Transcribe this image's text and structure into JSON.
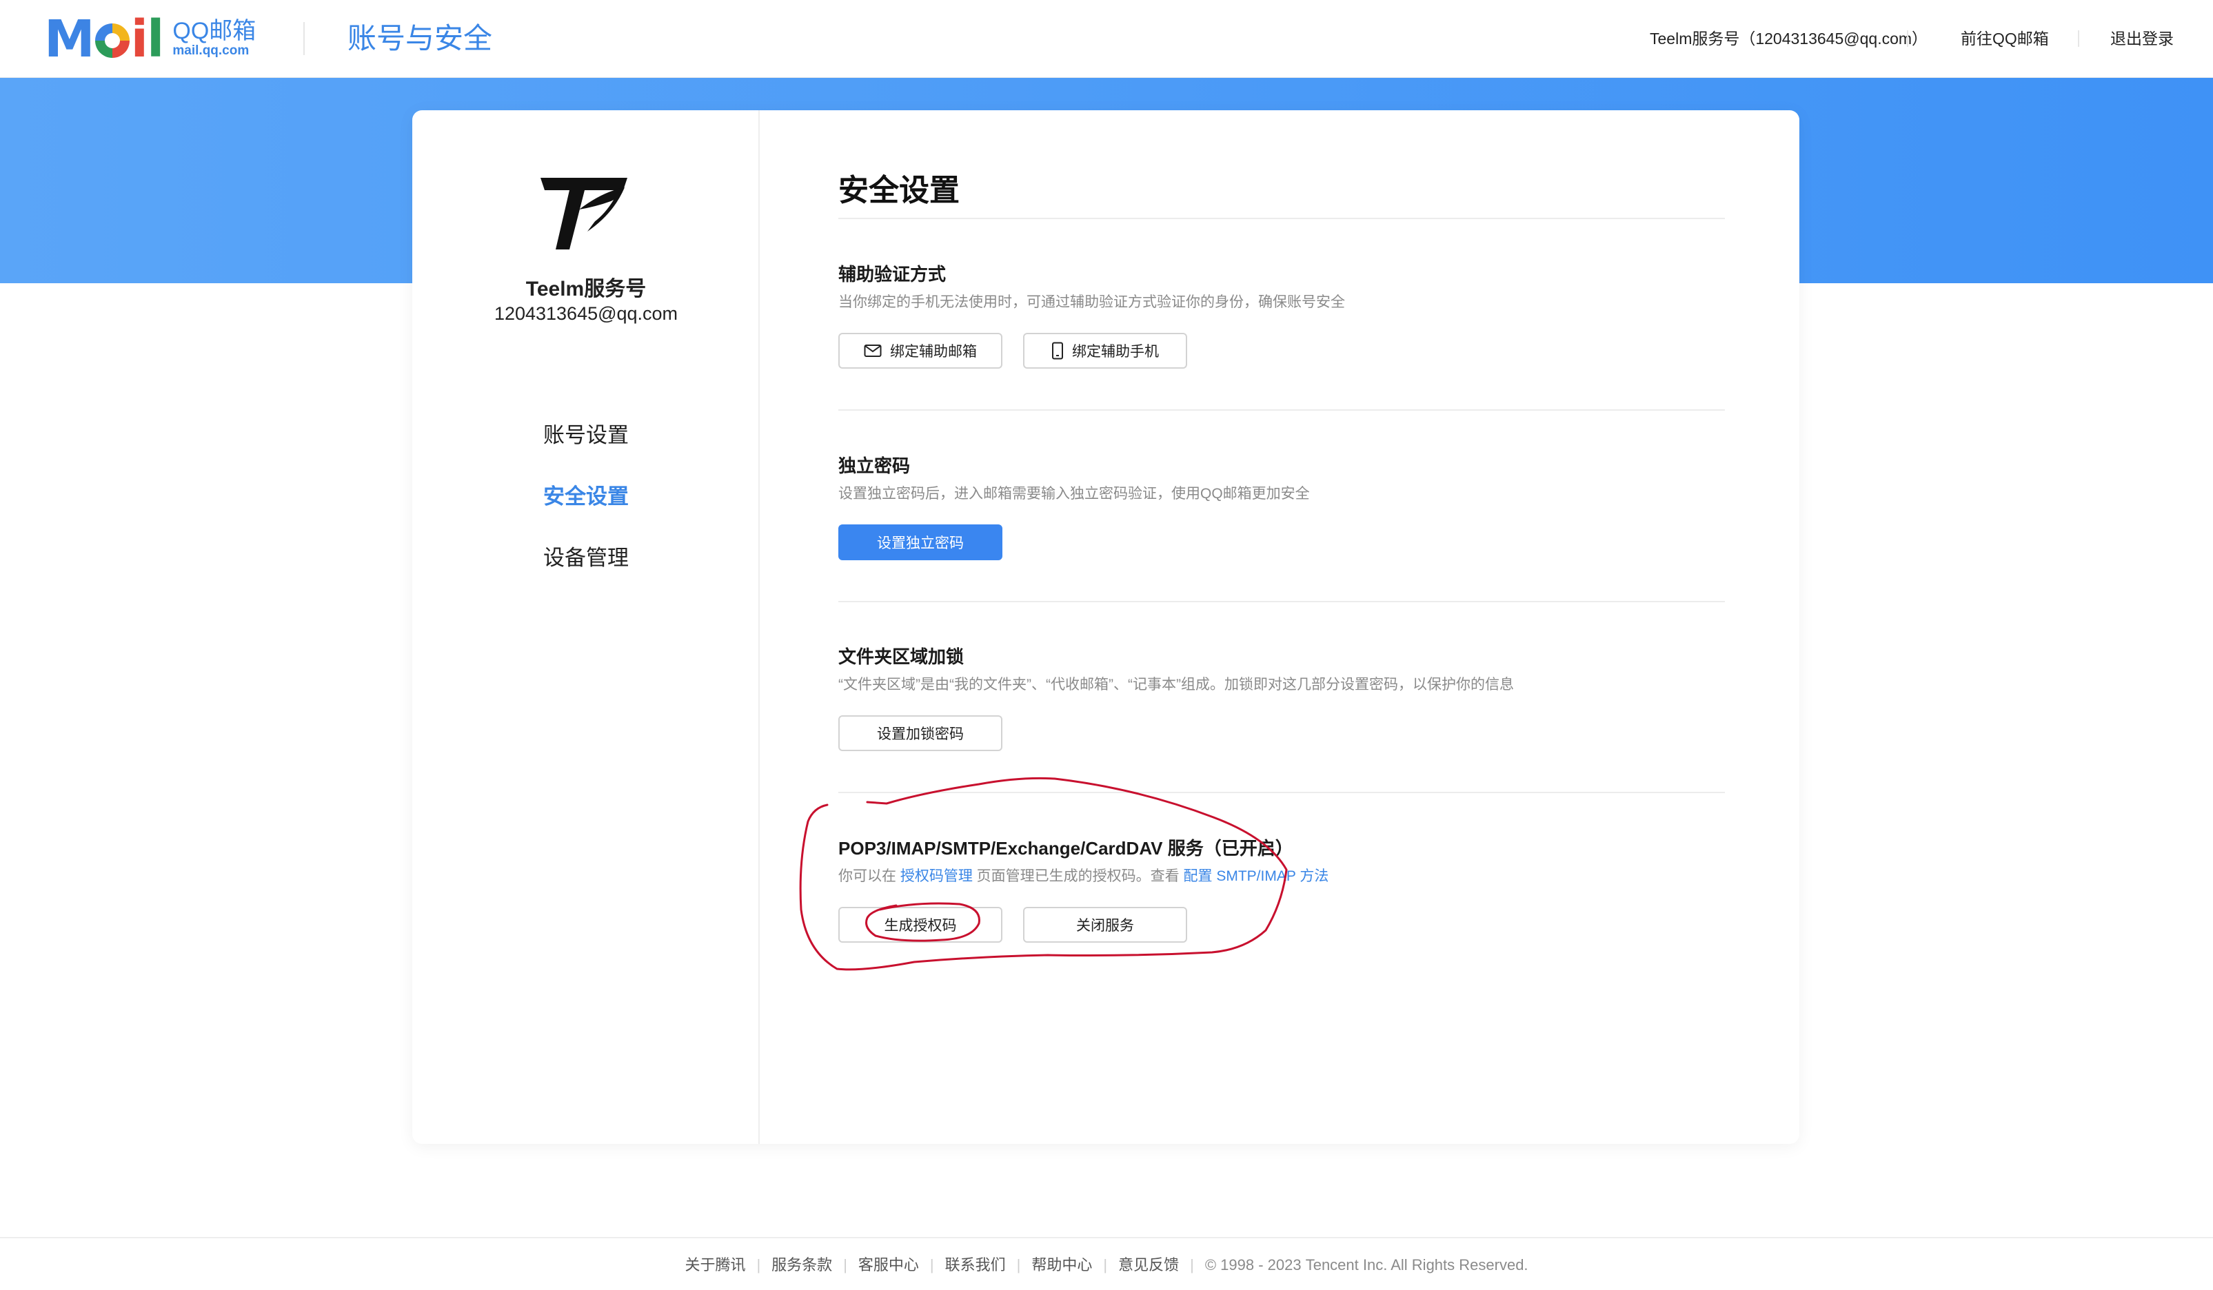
{
  "header": {
    "logo_wordmark": "Mail",
    "logo_cn": "QQ邮箱",
    "logo_url": "mail.qq.com",
    "title": "账号与安全",
    "account_label": "Teelm服务号（1204313645@qq.com）",
    "goto_mail": "前往QQ邮箱",
    "logout": "退出登录"
  },
  "sidebar": {
    "user_name": "Teelm服务号",
    "user_email": "1204313645@qq.com",
    "nav": [
      {
        "label": "账号设置"
      },
      {
        "label": "安全设置"
      },
      {
        "label": "设备管理"
      }
    ]
  },
  "main": {
    "title": "安全设置",
    "sections": [
      {
        "title": "辅助验证方式",
        "desc": "当你绑定的手机无法使用时，可通过辅助验证方式验证你的身份，确保账号安全",
        "buttons": [
          "绑定辅助邮箱",
          "绑定辅助手机"
        ]
      },
      {
        "title": "独立密码",
        "desc": "设置独立密码后，进入邮箱需要输入独立密码验证，使用QQ邮箱更加安全",
        "buttons": [
          "设置独立密码"
        ]
      },
      {
        "title": "文件夹区域加锁",
        "desc": "“文件夹区域”是由“我的文件夹”、“代收邮箱”、“记事本”组成。加锁即对这几部分设置密码，以保护你的信息",
        "buttons": [
          "设置加锁密码"
        ]
      },
      {
        "title": "POP3/IMAP/SMTP/Exchange/CardDAV 服务（已开启）",
        "desc_prefix": "你可以在 ",
        "desc_link1": "授权码管理",
        "desc_middle": " 页面管理已生成的授权码。查看 ",
        "desc_link2": "配置 SMTP/IMAP 方法",
        "buttons": [
          "生成授权码",
          "关闭服务"
        ]
      }
    ]
  },
  "colors": {
    "accent": "#3a86e6",
    "banner": "#4a9af7",
    "annotation": "#c8102e"
  },
  "footer": {
    "links": [
      "关于腾讯",
      "服务条款",
      "客服中心",
      "联系我们",
      "帮助中心",
      "意见反馈"
    ],
    "copyright": "© 1998 - 2023 Tencent Inc. All Rights Reserved."
  }
}
